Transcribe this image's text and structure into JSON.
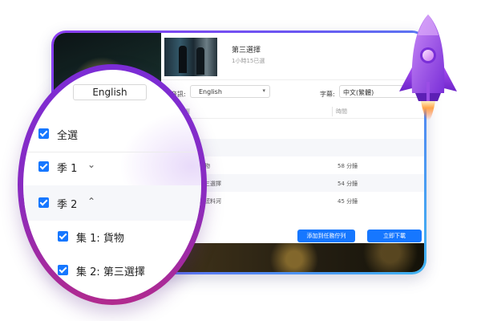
{
  "episode": {
    "title": "第三選擇",
    "subtitle": "1小時15已選"
  },
  "settings": {
    "audio_label": "音訊:",
    "audio_value": "English",
    "subtitle_label": "字幕:",
    "subtitle_value": "中文(繁體)"
  },
  "table": {
    "header_all": "全選",
    "header_time": "時間",
    "rows": [
      {
        "name": "物",
        "duration": "58 分鐘"
      },
      {
        "name": "三選擇",
        "duration": "54 分鐘"
      },
      {
        "name": "謊料河",
        "duration": "45 分鐘"
      }
    ]
  },
  "buttons": {
    "add_queue": "添加到任務佇列",
    "download_now": "立即下載"
  },
  "lens": {
    "audio_value": "English",
    "select_all": "全選",
    "season1": "季 1",
    "season2": "季 2",
    "episode1": "集 1: 貨物",
    "episode2": "集 2: 第三選擇"
  },
  "colors": {
    "accent": "#1677ff",
    "lens_ring_top": "#7b2cd6",
    "lens_ring_bottom": "#b12a8e",
    "window_border_start": "#8b3cf0",
    "window_border_end": "#3fb4f2"
  },
  "icons": [
    "checkbox-checked-icon",
    "chevron-down-icon",
    "chevron-up-icon",
    "dropdown-caret-icon",
    "rocket-icon"
  ]
}
